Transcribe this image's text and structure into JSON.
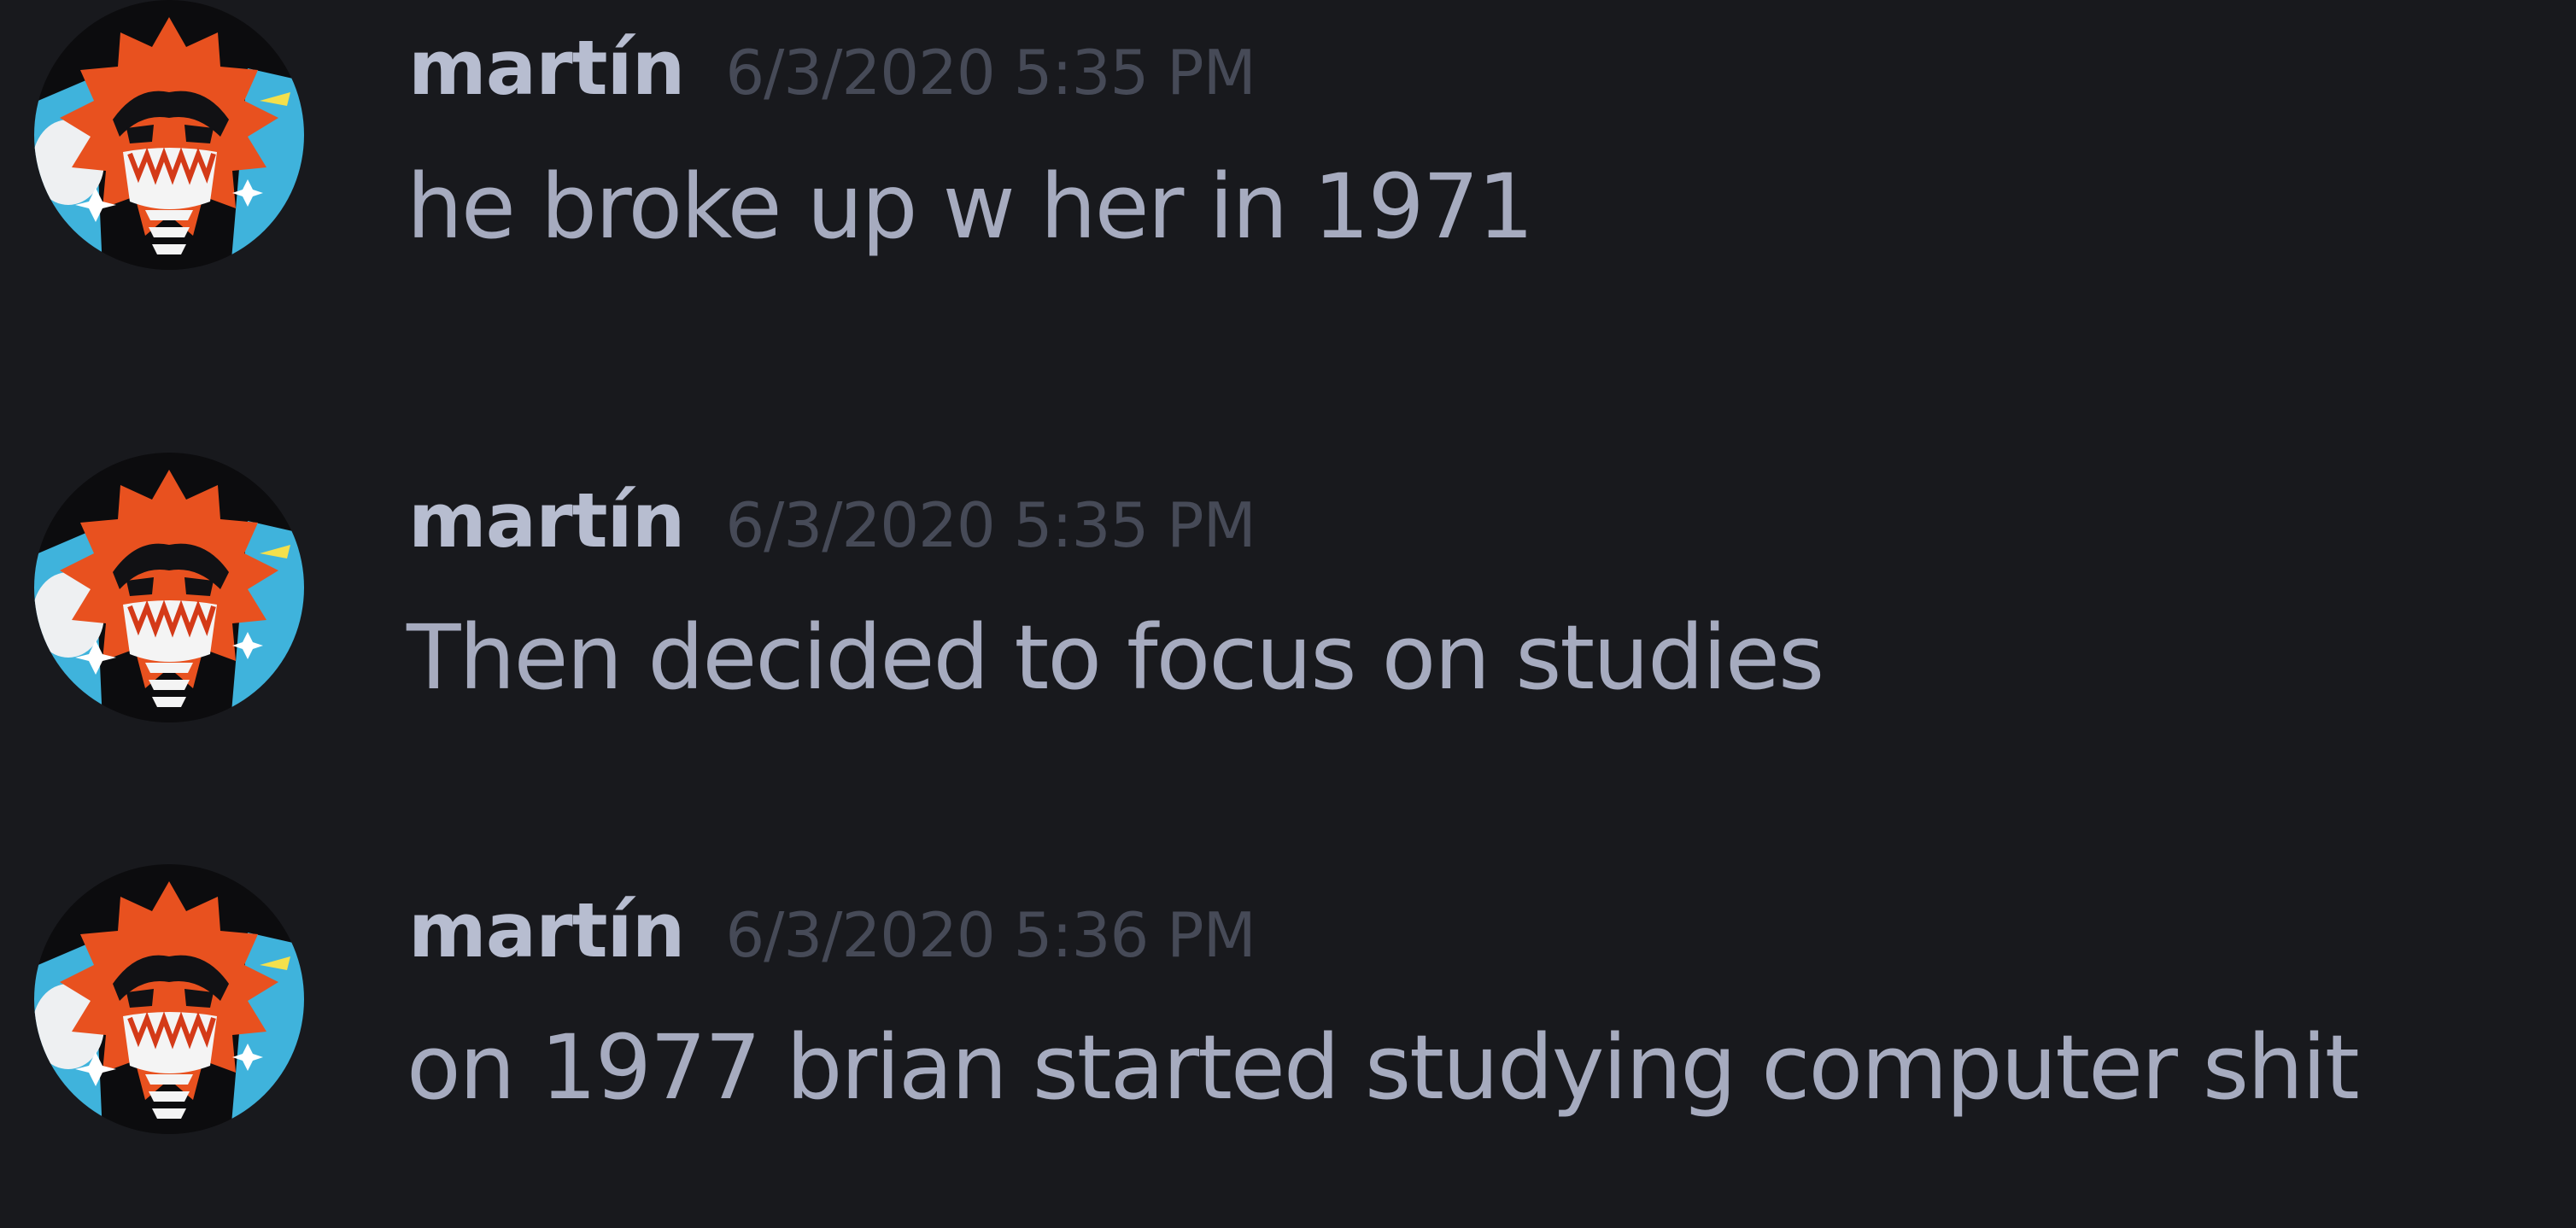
{
  "messages": [
    {
      "author": "martín",
      "timestamp": "6/3/2020 5:35 PM",
      "text": "he broke up w her in 1971",
      "avatar_icon": "cartoon-face-avatar-icon"
    },
    {
      "author": "martín",
      "timestamp": "6/3/2020 5:35 PM",
      "text": "Then decided to focus on studies",
      "avatar_icon": "cartoon-face-avatar-icon"
    },
    {
      "author": "martín",
      "timestamp": "6/3/2020 5:36 PM",
      "text": "on 1977 brian started studying computer shit",
      "avatar_icon": "cartoon-face-avatar-icon"
    }
  ],
  "colors": {
    "background": "#18191d",
    "username": "#b7bdd0",
    "timestamp": "#464a57",
    "message_text": "#a6abbf",
    "avatar_orange": "#e8511f",
    "avatar_blue": "#3fb3dc"
  }
}
